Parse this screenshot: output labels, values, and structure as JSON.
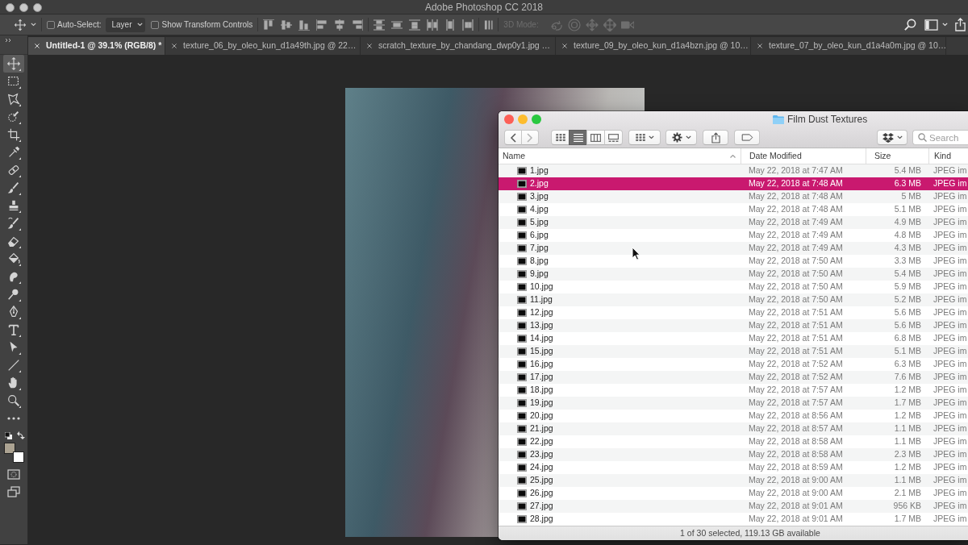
{
  "app_window": {
    "title": "Adobe Photoshop CC 2018"
  },
  "options_bar": {
    "auto_select": {
      "label": "Auto-Select:",
      "checked": false
    },
    "layer_dropdown": {
      "value": "Layer"
    },
    "transform_controls": {
      "label": "Show Transform Controls",
      "checked": false
    },
    "three_d_mode": {
      "label": "3D Mode:",
      "disabled": true
    }
  },
  "document_tabs": [
    {
      "label": "Untitled-1 @ 39.1% (RGB/8) *",
      "selected": true
    },
    {
      "label": "texture_06_by_oleo_kun_d1a49th.jpg @ 22…",
      "selected": false
    },
    {
      "label": "scratch_texture_by_chandang_dwp0y1.jpg …",
      "selected": false
    },
    {
      "label": "texture_09_by_oleo_kun_d1a4bzn.jpg @ 10…",
      "selected": false
    },
    {
      "label": "texture_07_by_oleo_kun_d1a4a0m.jpg @ 10…",
      "selected": false
    }
  ],
  "tools": [
    {
      "kind": "move",
      "selected": true
    },
    {
      "kind": "marquee",
      "selected": false
    },
    {
      "kind": "lasso",
      "selected": false
    },
    {
      "kind": "quickselect",
      "selected": false
    },
    {
      "kind": "crop",
      "selected": false
    },
    {
      "kind": "eyedropper",
      "selected": false
    },
    {
      "kind": "healing",
      "selected": false
    },
    {
      "kind": "brush",
      "selected": false
    },
    {
      "kind": "stamp",
      "selected": false
    },
    {
      "kind": "historybrush",
      "selected": false
    },
    {
      "kind": "eraser",
      "selected": false
    },
    {
      "kind": "bucket",
      "selected": false
    },
    {
      "kind": "smudge",
      "selected": false
    },
    {
      "kind": "dodge",
      "selected": false
    },
    {
      "kind": "pen",
      "selected": false
    },
    {
      "kind": "type",
      "selected": false
    },
    {
      "kind": "pathselect",
      "selected": false
    },
    {
      "kind": "line",
      "selected": false
    },
    {
      "kind": "hand",
      "selected": false
    },
    {
      "kind": "zoom",
      "selected": false
    },
    {
      "kind": "more",
      "selected": false
    }
  ],
  "color_swatches": [
    {
      "kind": "foreground",
      "color": "#aca392"
    },
    {
      "kind": "background",
      "color": "#ffffff"
    }
  ],
  "finder": {
    "title": "Film Dust Textures",
    "navigation": [
      {
        "kind": "back",
        "disabled": false
      },
      {
        "kind": "forward",
        "disabled": true
      }
    ],
    "view_modes": [
      {
        "kind": "icons",
        "selected": false
      },
      {
        "kind": "list",
        "selected": true
      },
      {
        "kind": "columns",
        "selected": false
      },
      {
        "kind": "gallery",
        "selected": false
      }
    ],
    "search": {
      "placeholder": "Search"
    },
    "columns": [
      {
        "label": "Name",
        "sorted": true
      },
      {
        "label": "Date Modified",
        "sorted": false
      },
      {
        "label": "Size",
        "sorted": false
      },
      {
        "label": "Kind",
        "sorted": false
      }
    ],
    "files": [
      {
        "name": "1.jpg",
        "date_modified": "May 22, 2018 at 7:47 AM",
        "size": "5.4 MB",
        "file_kind": "JPEG im",
        "selected": false
      },
      {
        "name": "2.jpg",
        "date_modified": "May 22, 2018 at 7:48 AM",
        "size": "6.3 MB",
        "file_kind": "JPEG im",
        "selected": true
      },
      {
        "name": "3.jpg",
        "date_modified": "May 22, 2018 at 7:48 AM",
        "size": "5 MB",
        "file_kind": "JPEG im",
        "selected": false
      },
      {
        "name": "4.jpg",
        "date_modified": "May 22, 2018 at 7:48 AM",
        "size": "5.1 MB",
        "file_kind": "JPEG im",
        "selected": false
      },
      {
        "name": "5.jpg",
        "date_modified": "May 22, 2018 at 7:49 AM",
        "size": "4.9 MB",
        "file_kind": "JPEG im",
        "selected": false
      },
      {
        "name": "6.jpg",
        "date_modified": "May 22, 2018 at 7:49 AM",
        "size": "4.8 MB",
        "file_kind": "JPEG im",
        "selected": false
      },
      {
        "name": "7.jpg",
        "date_modified": "May 22, 2018 at 7:49 AM",
        "size": "4.3 MB",
        "file_kind": "JPEG im",
        "selected": false
      },
      {
        "name": "8.jpg",
        "date_modified": "May 22, 2018 at 7:50 AM",
        "size": "3.3 MB",
        "file_kind": "JPEG im",
        "selected": false
      },
      {
        "name": "9.jpg",
        "date_modified": "May 22, 2018 at 7:50 AM",
        "size": "5.4 MB",
        "file_kind": "JPEG im",
        "selected": false
      },
      {
        "name": "10.jpg",
        "date_modified": "May 22, 2018 at 7:50 AM",
        "size": "5.9 MB",
        "file_kind": "JPEG im",
        "selected": false
      },
      {
        "name": "11.jpg",
        "date_modified": "May 22, 2018 at 7:50 AM",
        "size": "5.2 MB",
        "file_kind": "JPEG im",
        "selected": false
      },
      {
        "name": "12.jpg",
        "date_modified": "May 22, 2018 at 7:51 AM",
        "size": "5.6 MB",
        "file_kind": "JPEG im",
        "selected": false
      },
      {
        "name": "13.jpg",
        "date_modified": "May 22, 2018 at 7:51 AM",
        "size": "5.6 MB",
        "file_kind": "JPEG im",
        "selected": false
      },
      {
        "name": "14.jpg",
        "date_modified": "May 22, 2018 at 7:51 AM",
        "size": "6.8 MB",
        "file_kind": "JPEG im",
        "selected": false
      },
      {
        "name": "15.jpg",
        "date_modified": "May 22, 2018 at 7:51 AM",
        "size": "5.1 MB",
        "file_kind": "JPEG im",
        "selected": false
      },
      {
        "name": "16.jpg",
        "date_modified": "May 22, 2018 at 7:52 AM",
        "size": "6.3 MB",
        "file_kind": "JPEG im",
        "selected": false
      },
      {
        "name": "17.jpg",
        "date_modified": "May 22, 2018 at 7:52 AM",
        "size": "7.6 MB",
        "file_kind": "JPEG im",
        "selected": false
      },
      {
        "name": "18.jpg",
        "date_modified": "May 22, 2018 at 7:57 AM",
        "size": "1.2 MB",
        "file_kind": "JPEG im",
        "selected": false
      },
      {
        "name": "19.jpg",
        "date_modified": "May 22, 2018 at 7:57 AM",
        "size": "1.7 MB",
        "file_kind": "JPEG im",
        "selected": false
      },
      {
        "name": "20.jpg",
        "date_modified": "May 22, 2018 at 8:56 AM",
        "size": "1.2 MB",
        "file_kind": "JPEG im",
        "selected": false
      },
      {
        "name": "21.jpg",
        "date_modified": "May 22, 2018 at 8:57 AM",
        "size": "1.1 MB",
        "file_kind": "JPEG im",
        "selected": false
      },
      {
        "name": "22.jpg",
        "date_modified": "May 22, 2018 at 8:58 AM",
        "size": "1.1 MB",
        "file_kind": "JPEG im",
        "selected": false
      },
      {
        "name": "23.jpg",
        "date_modified": "May 22, 2018 at 8:58 AM",
        "size": "2.3 MB",
        "file_kind": "JPEG im",
        "selected": false
      },
      {
        "name": "24.jpg",
        "date_modified": "May 22, 2018 at 8:59 AM",
        "size": "1.2 MB",
        "file_kind": "JPEG im",
        "selected": false
      },
      {
        "name": "25.jpg",
        "date_modified": "May 22, 2018 at 9:00 AM",
        "size": "1.1 MB",
        "file_kind": "JPEG im",
        "selected": false
      },
      {
        "name": "26.jpg",
        "date_modified": "May 22, 2018 at 9:00 AM",
        "size": "2.1 MB",
        "file_kind": "JPEG im",
        "selected": false
      },
      {
        "name": "27.jpg",
        "date_modified": "May 22, 2018 at 9:01 AM",
        "size": "956 KB",
        "file_kind": "JPEG im",
        "selected": false
      },
      {
        "name": "28.jpg",
        "date_modified": "May 22, 2018 at 9:01 AM",
        "size": "1.7 MB",
        "file_kind": "JPEG im",
        "selected": false
      }
    ],
    "status": "1 of 30 selected, 119.13 GB available"
  }
}
